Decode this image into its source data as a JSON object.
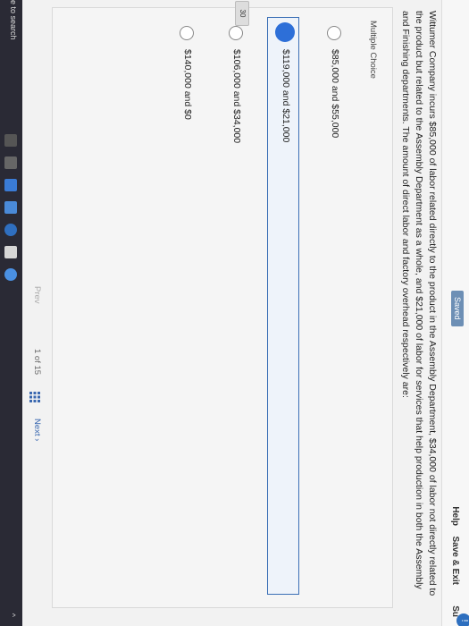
{
  "header": {
    "saved_label": "Saved",
    "help_label": "Help",
    "save_exit_label": "Save & Exit",
    "submit_partial": "Su"
  },
  "question": {
    "text": "Wittumer Company incurs $85,000 of labor related directly to the product in the Assembly Department, $34,000 of labor not directly related to the product but related to the Assembly Department as a whole, and $21,000 of labor for services that help production in both the Assembly and Finishing departments. The amount of direct labor and factory overhead respectively are:",
    "number_badge": "30",
    "type_label": "Multiple Choice"
  },
  "options": [
    {
      "text": "$85,000 and $55,000",
      "selected": false
    },
    {
      "text": "$119,000 and $21,000",
      "selected": true
    },
    {
      "text": "$106,000 and $34,000",
      "selected": false
    },
    {
      "text": "$140,000 and $0",
      "selected": false
    }
  ],
  "pager": {
    "prev_label": "Prev",
    "position": "1 of 15",
    "next_label": "Next"
  },
  "taskbar": {
    "search_text": "e to search",
    "tray_text": "^"
  },
  "colors": {
    "accent": "#2d6fd8",
    "saved_badge": "#6d8fb5",
    "next": "#3a68b0"
  }
}
